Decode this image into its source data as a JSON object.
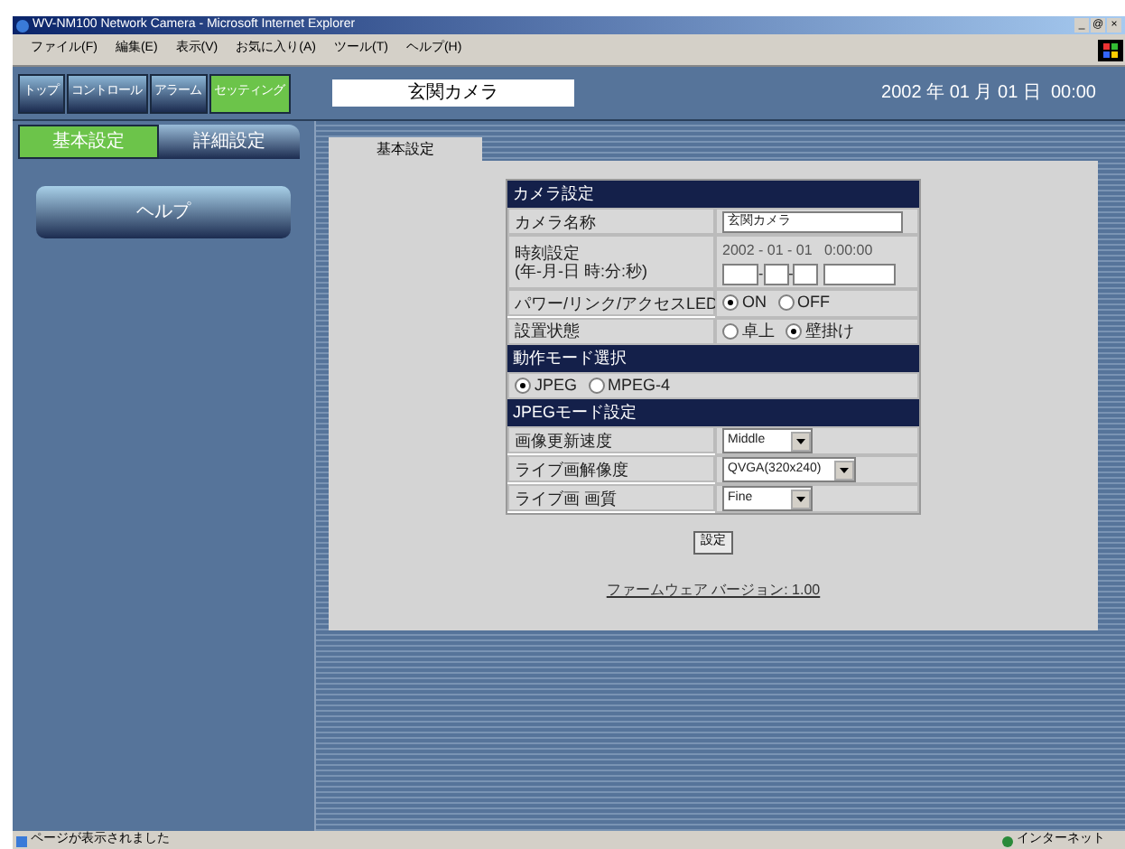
{
  "window": {
    "title": "WV-NM100 Network Camera - Microsoft Internet Explorer",
    "controls": [
      "_",
      "@",
      "×"
    ]
  },
  "menu": [
    "ファイル(F)",
    "編集(E)",
    "表示(V)",
    "お気に入り(A)",
    "ツール(T)",
    "ヘルプ(H)"
  ],
  "nav_tabs": [
    {
      "label": "トップ",
      "selected": false
    },
    {
      "label": "コントロール",
      "selected": false
    },
    {
      "label": "アラーム",
      "selected": false
    },
    {
      "label": "セッティング",
      "selected": true
    }
  ],
  "camera_title": "玄関カメラ",
  "datetime": "2002 年 01 月 01 日  00:00",
  "sub_tabs": [
    {
      "label": "基本設定",
      "selected": true
    },
    {
      "label": "詳細設定",
      "selected": false
    }
  ],
  "help_button": "ヘルプ",
  "content_tab": "基本設定",
  "sections": [
    {
      "header": "カメラ設定",
      "rows": [
        {
          "kind": "text",
          "label": "カメラ名称",
          "value": "玄関カメラ"
        },
        {
          "kind": "datetime",
          "label": "時刻設定",
          "sublabel": "(年-月-日 時:分:秒)",
          "value": "2002 - 01 - 01   0:00:00",
          "separators": [
            "-",
            "-"
          ]
        },
        {
          "kind": "radio",
          "label": "パワー/リンク/アクセスLED",
          "options": [
            {
              "label": "ON",
              "selected": true
            },
            {
              "label": "OFF",
              "selected": false
            }
          ]
        },
        {
          "kind": "radio",
          "label": "設置状態",
          "options": [
            {
              "label": "卓上",
              "selected": false
            },
            {
              "label": "壁掛け",
              "selected": true
            }
          ]
        }
      ]
    },
    {
      "header": "動作モード選択",
      "rows": [
        {
          "kind": "radio_full",
          "options": [
            {
              "label": "JPEG",
              "selected": true
            },
            {
              "label": "MPEG-4",
              "selected": false
            }
          ]
        }
      ]
    },
    {
      "header": "JPEGモード設定",
      "rows": [
        {
          "kind": "select",
          "label": "画像更新速度",
          "value": "Middle"
        },
        {
          "kind": "select",
          "label": "ライブ画解像度",
          "value": "QVGA(320x240)"
        },
        {
          "kind": "select",
          "label": "ライブ画 画質",
          "value": "Fine"
        }
      ]
    }
  ],
  "submit_button": "設定",
  "firmware_link": "ファームウェア バージョン: 1.00",
  "status_bar": {
    "message": "ページが表示されました",
    "zone": "インターネット"
  }
}
